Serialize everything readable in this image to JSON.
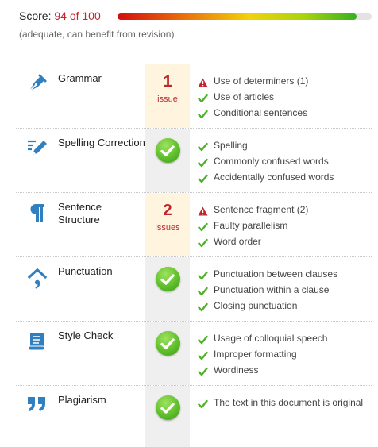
{
  "score": {
    "label": "Score:",
    "value": "94 of 100",
    "progress_fraction": 0.94,
    "subtitle": "(adequate, can benefit from revision)"
  },
  "colors": {
    "issue_red": "#c0272d",
    "check_green": "#4fb12b",
    "issue_bg": "#fff4de",
    "ok_bg": "#efefef"
  },
  "rows": [
    {
      "title": "Grammar",
      "icon": "pen-nib-icon",
      "status": "issue",
      "count": "1",
      "count_label": "issue",
      "checks": [
        {
          "text": "Use of determiners (1)",
          "state": "warning"
        },
        {
          "text": "Use of articles",
          "state": "ok"
        },
        {
          "text": "Conditional sentences",
          "state": "ok"
        }
      ]
    },
    {
      "title": "Spelling Correction",
      "icon": "pencil-lines-icon",
      "status": "ok",
      "checks": [
        {
          "text": "Spelling",
          "state": "ok"
        },
        {
          "text": "Commonly confused words",
          "state": "ok"
        },
        {
          "text": "Accidentally confused words",
          "state": "ok"
        }
      ]
    },
    {
      "title": "Sentence Structure",
      "icon": "pilcrow-icon",
      "status": "issue",
      "count": "2",
      "count_label": "issues",
      "checks": [
        {
          "text": "Sentence fragment (2)",
          "state": "warning"
        },
        {
          "text": "Faulty parallelism",
          "state": "ok"
        },
        {
          "text": "Word order",
          "state": "ok"
        }
      ]
    },
    {
      "title": "Punctuation",
      "icon": "punctuation-icon",
      "status": "ok",
      "checks": [
        {
          "text": "Punctuation between clauses",
          "state": "ok"
        },
        {
          "text": "Punctuation within a clause",
          "state": "ok"
        },
        {
          "text": "Closing punctuation",
          "state": "ok"
        }
      ]
    },
    {
      "title": "Style Check",
      "icon": "scroll-icon",
      "status": "ok",
      "checks": [
        {
          "text": "Usage of colloquial speech",
          "state": "ok"
        },
        {
          "text": "Improper formatting",
          "state": "ok"
        },
        {
          "text": "Wordiness",
          "state": "ok"
        }
      ]
    },
    {
      "title": "Plagiarism",
      "icon": "quote-marks-icon",
      "status": "ok",
      "checks": [
        {
          "text": "The text in this document is original",
          "state": "ok"
        }
      ]
    }
  ]
}
